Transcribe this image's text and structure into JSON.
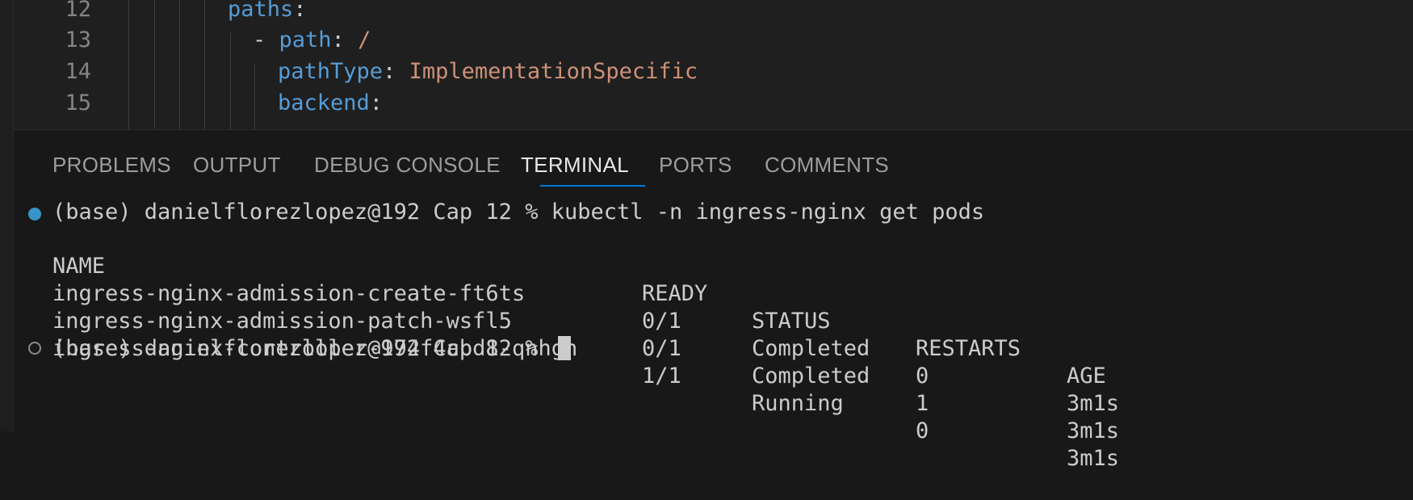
{
  "editor": {
    "lines": [
      {
        "number": "12",
        "key": "paths",
        "colon": ":",
        "value": ""
      },
      {
        "number": "13",
        "dash": "- ",
        "key": "path",
        "colon": ": ",
        "value": "/"
      },
      {
        "number": "14",
        "key": "pathType",
        "colon": ": ",
        "value": "ImplementationSpecific"
      },
      {
        "number": "15",
        "key": "backend",
        "colon": ":",
        "value": ""
      }
    ]
  },
  "panel": {
    "tabs": [
      "PROBLEMS",
      "OUTPUT",
      "DEBUG CONSOLE",
      "TERMINAL",
      "PORTS",
      "COMMENTS"
    ],
    "active_tab": "TERMINAL"
  },
  "terminal": {
    "command_line": "(base) danielflorezlopez@192 Cap 12 % kubectl -n ingress-nginx get pods",
    "headers": [
      "NAME",
      "READY",
      "STATUS",
      "RESTARTS",
      "AGE"
    ],
    "rows": [
      [
        "ingress-nginx-admission-create-ft6ts",
        "0/1",
        "Completed",
        "0",
        "3m1s"
      ],
      [
        "ingress-nginx-admission-patch-wsfl5",
        "0/1",
        "Completed",
        "1",
        "3m1s"
      ],
      [
        "ingress-nginx-controller-974f4cbd8-qnhgn",
        "1/1",
        "Running",
        "0",
        "3m1s"
      ]
    ],
    "prompt": "(base) danielflorezlopez@192 Cap 12 % "
  },
  "colors": {
    "accent": "#0078d4",
    "yaml_key": "#569cd6",
    "yaml_string": "#ce9178",
    "success_dot": "#3794c8"
  }
}
